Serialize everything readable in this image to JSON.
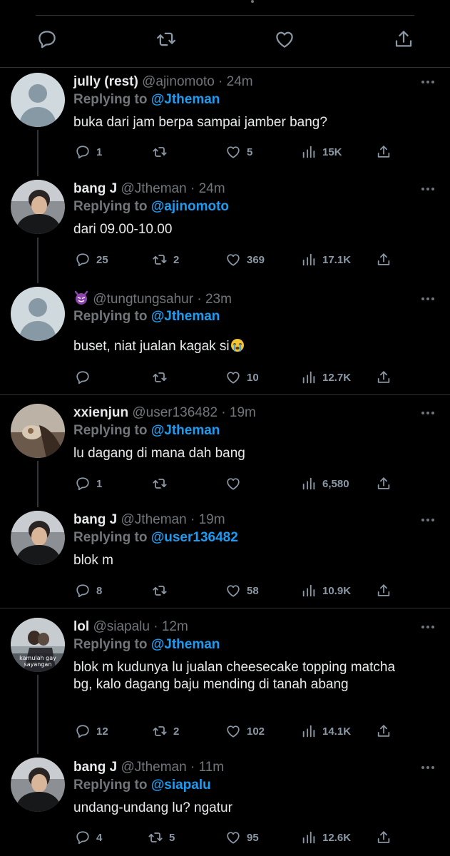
{
  "tweets": [
    {
      "name": "jully (rest)",
      "handle": "@ajinomoto",
      "sep": "·",
      "time": "24m",
      "reply_prefix": "Replying to",
      "reply_to": "@Jtheman",
      "text": "buka dari jam berpa sampai jamber bang?",
      "replies": "1",
      "retweets": "",
      "likes": "5",
      "views": "15K",
      "avatar": "default-avatar"
    },
    {
      "name": "bang J",
      "handle": "@Jtheman",
      "sep": "·",
      "time": "24m",
      "reply_prefix": "Replying to",
      "reply_to": "@ajinomoto",
      "text": "dari 09.00-10.00",
      "replies": "25",
      "retweets": "2",
      "likes": "369",
      "views": "17.1K",
      "avatar": "photo-avatar"
    },
    {
      "name": "",
      "handle": "@tungtungsahur",
      "sep": "·",
      "time": "23m",
      "reply_prefix": "Replying to",
      "reply_to": "@Jtheman",
      "text": "buset, niat jualan kagak si",
      "replies": "",
      "retweets": "",
      "likes": "10",
      "views": "12.7K",
      "avatar": "default-avatar"
    },
    {
      "name": "xxienjun",
      "handle": "@user136482",
      "sep": "·",
      "time": "19m",
      "reply_prefix": "Replying to",
      "reply_to": "@Jtheman",
      "text": "lu dagang di mana dah bang",
      "replies": "1",
      "retweets": "",
      "likes": "",
      "views": "6,580",
      "avatar": "photo-avatar"
    },
    {
      "name": "bang J",
      "handle": "@Jtheman",
      "sep": "·",
      "time": "19m",
      "reply_prefix": "Replying to",
      "reply_to": "@user136482",
      "text": "blok m",
      "replies": "8",
      "retweets": "",
      "likes": "58",
      "views": "10.9K",
      "avatar": "photo-avatar"
    },
    {
      "name": "lol",
      "handle": "@siapalu",
      "sep": "·",
      "time": "12m",
      "reply_prefix": "Replying to",
      "reply_to": "@Jtheman",
      "text": "blok m kudunya lu jualan cheesecake topping matcha bg, kalo dagang baju mending di tanah abang",
      "replies": "12",
      "retweets": "2",
      "likes": "102",
      "views": "14.1K",
      "avatar": "photo-avatar",
      "avatar_caption": "kamulah gay sayangan"
    },
    {
      "name": "bang J",
      "handle": "@Jtheman",
      "sep": "·",
      "time": "11m",
      "reply_prefix": "Replying to",
      "reply_to": "@siapalu",
      "text": "undang-undang lu? ngatur",
      "replies": "4",
      "retweets": "5",
      "likes": "95",
      "views": "12.6K",
      "avatar": "photo-avatar"
    }
  ],
  "icons": {
    "top": [
      "reply-icon",
      "retweet-icon",
      "like-icon",
      "share-icon"
    ],
    "actions": [
      "reply-icon",
      "retweet-icon",
      "like-icon",
      "views-icon",
      "share-icon"
    ],
    "more": "more-options-icon"
  },
  "colors": {
    "background": "#000000",
    "text": "#e7e9ea",
    "muted": "#71767b",
    "mention": "#1d9bf0",
    "divider": "#2f3336"
  }
}
